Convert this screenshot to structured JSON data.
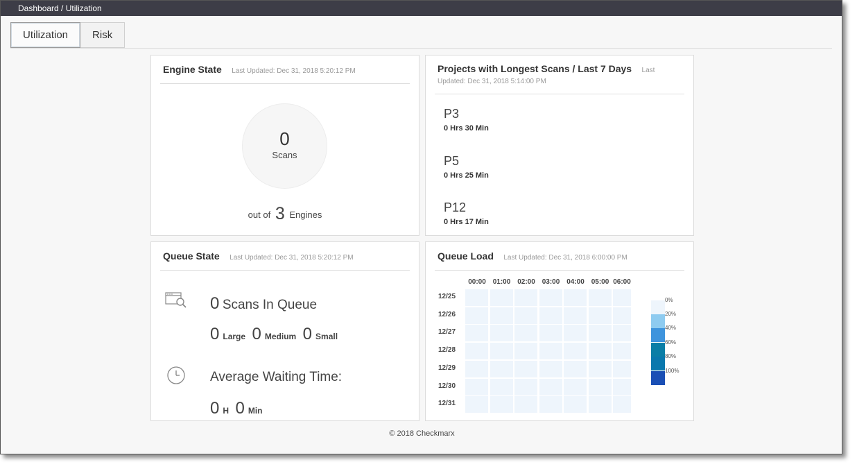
{
  "breadcrumb": "Dashboard / Utilization",
  "tabs": [
    {
      "label": "Utilization",
      "active": true
    },
    {
      "label": "Risk",
      "active": false
    }
  ],
  "engine_state": {
    "title": "Engine State",
    "updated": "Last Updated: Dec 31, 2018 5:20:12 PM",
    "scans_count": "0",
    "scans_label": "Scans",
    "out_of_prefix": "out of",
    "engines_count": "3",
    "engines_label": "Engines"
  },
  "projects": {
    "title": "Projects with Longest Scans / Last 7 Days",
    "updated": "Last Updated: Dec 31, 2018 5:14:00 PM",
    "items": [
      {
        "name": "P3",
        "duration": "0 Hrs 30 Min"
      },
      {
        "name": "P5",
        "duration": "0 Hrs 25 Min"
      },
      {
        "name": "P12",
        "duration": "0 Hrs 17 Min"
      }
    ]
  },
  "queue_state": {
    "title": "Queue State",
    "updated": "Last Updated: Dec 31, 2018 5:20:12 PM",
    "scans_in_queue_count": "0",
    "scans_in_queue_label": "Scans In Queue",
    "large_count": "0",
    "large_label": "Large",
    "medium_count": "0",
    "medium_label": "Medium",
    "small_count": "0",
    "small_label": "Small",
    "avg_wait_label": "Average Waiting Time:",
    "hours": "0",
    "hours_unit": "H",
    "minutes": "0",
    "minutes_unit": "Min",
    "icons": [
      "queue-search-icon",
      "clock-icon"
    ]
  },
  "queue_load": {
    "title": "Queue Load",
    "updated": "Last Updated: Dec 31, 2018 6:00:00 PM",
    "hours": [
      "00:00",
      "01:00",
      "02:00",
      "03:00",
      "04:00",
      "05:00",
      "06:00"
    ],
    "days": [
      "12/25",
      "12/26",
      "12/27",
      "12/28",
      "12/29",
      "12/30",
      "12/31"
    ],
    "load_percent": 0,
    "cell_color": "#eef5fc",
    "legend": [
      {
        "label": "0%",
        "color": "#eef5fc"
      },
      {
        "label": "20%",
        "color": "#8ecbf0"
      },
      {
        "label": "40%",
        "color": "#3e94dd"
      },
      {
        "label": "60%",
        "color": "#0b7ea6"
      },
      {
        "label": "80%",
        "color": "#0a78ad"
      },
      {
        "label": "100%",
        "color": "#1a4fb5"
      }
    ]
  },
  "footer": "© 2018 Checkmarx"
}
